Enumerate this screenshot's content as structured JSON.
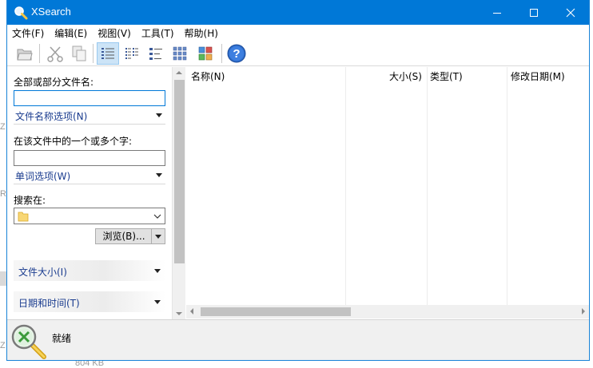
{
  "window": {
    "title": "XSearch"
  },
  "background_peek": {
    "text_a": "Z",
    "text_b": "R",
    "text_c": "Z",
    "text_d": "804 KB"
  },
  "menu": [
    {
      "label": "文件(F)"
    },
    {
      "label": "编辑(E)"
    },
    {
      "label": "视图(V)"
    },
    {
      "label": "工具(T)"
    },
    {
      "label": "帮助(H)"
    }
  ],
  "toolbar": {
    "icons": [
      "open-folder-icon",
      "cut-icon",
      "copy-icon",
      "details-view-icon",
      "list-view-icon",
      "small-icons-view-icon",
      "thumbnails-view-icon",
      "large-icons-view-icon",
      "help-icon"
    ],
    "active": "details-view-icon"
  },
  "search_pane": {
    "filename_label": "全部或部分文件名:",
    "filename_value": "",
    "filename_options": "文件名称选项(N)",
    "content_label": "在该文件中的一个或多个字:",
    "content_value": "",
    "word_options": "单词选项(W)",
    "search_in_label": "搜索在:",
    "search_in_value": "",
    "browse_button": "浏览(B)...",
    "file_size_section": "文件大小(I)",
    "date_time_section": "日期和时间(T)"
  },
  "results": {
    "columns": [
      "名称(N)",
      "大小(S)",
      "类型(T)",
      "修改日期(M)"
    ]
  },
  "status": {
    "text": "就绪"
  },
  "colors": {
    "titlebar": "#0078d7",
    "link_text": "#1a3c8f",
    "active_toolbar": "#cce4f7"
  }
}
